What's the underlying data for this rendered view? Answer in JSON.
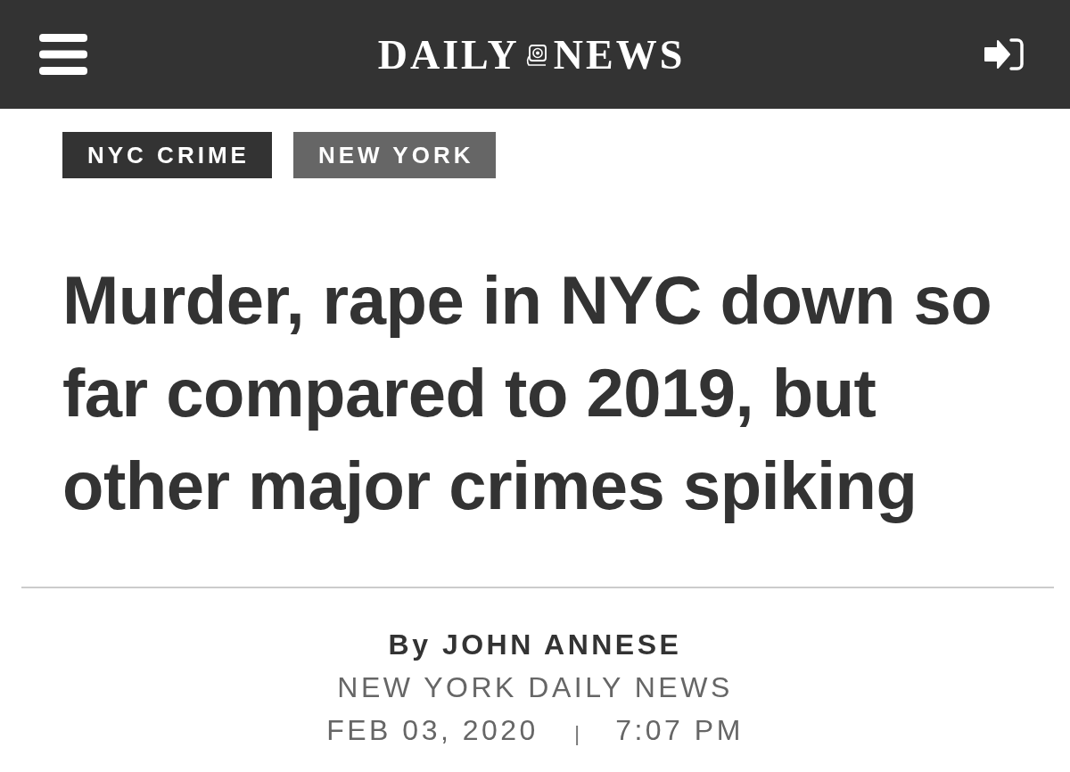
{
  "header": {
    "logo_words": [
      "DAILY",
      "NEWS"
    ]
  },
  "tags": [
    {
      "label": "NYC CRIME",
      "color": "#333333"
    },
    {
      "label": "NEW YORK",
      "color": "#666666"
    }
  ],
  "headline": "Murder, rape in NYC down so far compared to 2019, but other major crimes spiking",
  "byline": {
    "author": "By JOHN ANNESE",
    "publication": "NEW YORK DAILY NEWS",
    "date": "FEB 03, 2020",
    "separator": "|",
    "time": "7:07 PM"
  }
}
